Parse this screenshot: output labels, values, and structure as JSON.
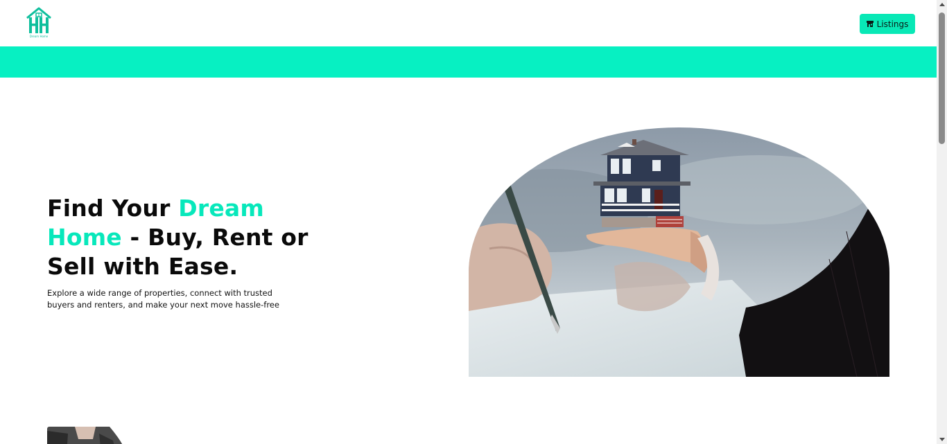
{
  "header": {
    "logo_icon": "house-hh-logo-icon",
    "logo_text": "Dream Home",
    "listings_button": {
      "icon": "store-icon",
      "label": "Listings"
    }
  },
  "hero": {
    "title_part1": "Find Your ",
    "title_accent": "Dream Home",
    "title_part2": " - Buy, Rent or Sell with Ease.",
    "subtitle": "Explore a wide range of properties, connect with trusted buyers and renters, and make your next move hassle-free",
    "image_label": "hand-holding-house-image"
  },
  "colors": {
    "accent": "#07f0c2",
    "button": "#08e8b6",
    "text": "#0a0a0a"
  }
}
